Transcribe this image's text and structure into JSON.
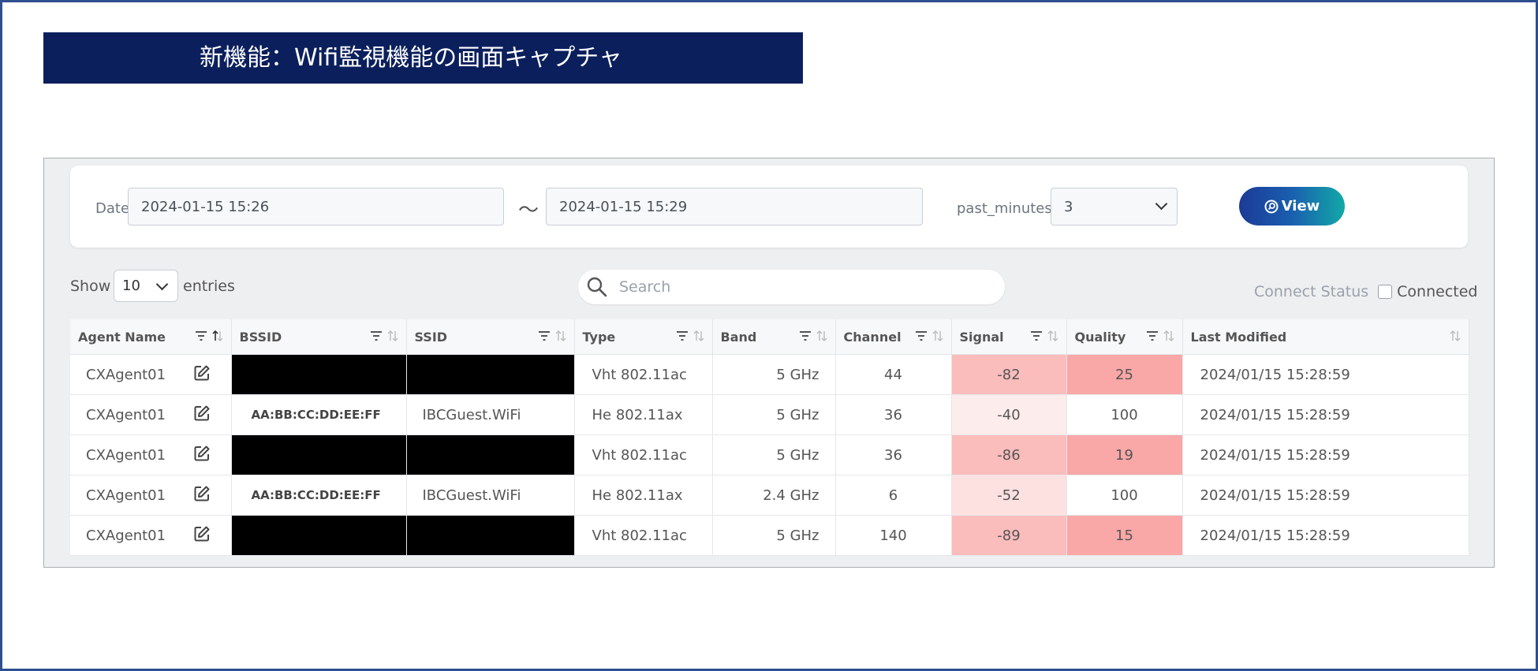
{
  "title": "新機能：Wifi監視機能の画面キャプチャ",
  "filter": {
    "date_label": "Date",
    "date_from": "2024-01-15 15:26",
    "separator": "〜",
    "date_to": "2024-01-15 15:29",
    "past_minutes_label": "past_minutes",
    "past_minutes_value": "3",
    "view_label": "View"
  },
  "table_controls": {
    "show_label": "Show",
    "entries_value": "10",
    "entries_label": "entries",
    "search_placeholder": "Search",
    "connect_status_label": "Connect Status",
    "connected_label": "Connected"
  },
  "columns": [
    "Agent Name",
    "BSSID",
    "SSID",
    "Type",
    "Band",
    "Channel",
    "Signal",
    "Quality",
    "Last Modified"
  ],
  "rows": [
    {
      "agent": "CXAgent01",
      "bssid": "",
      "ssid": "",
      "redacted": true,
      "type": "Vht 802.11ac",
      "band": "5 GHz",
      "channel": "44",
      "signal": "-82",
      "quality": "25",
      "modified": "2024/01/15 15:28:59"
    },
    {
      "agent": "CXAgent01",
      "bssid": "AA:BB:CC:DD:EE:FF",
      "ssid": "IBCGuest.WiFi",
      "redacted": false,
      "type": "He 802.11ax",
      "band": "5 GHz",
      "channel": "36",
      "signal": "-40",
      "quality": "100",
      "modified": "2024/01/15 15:28:59"
    },
    {
      "agent": "CXAgent01",
      "bssid": "",
      "ssid": "",
      "redacted": true,
      "type": "Vht 802.11ac",
      "band": "5 GHz",
      "channel": "36",
      "signal": "-86",
      "quality": "19",
      "modified": "2024/01/15 15:28:59"
    },
    {
      "agent": "CXAgent01",
      "bssid": "AA:BB:CC:DD:EE:FF",
      "ssid": "IBCGuest.WiFi",
      "redacted": false,
      "type": "He 802.11ax",
      "band": "2.4 GHz",
      "channel": "6",
      "signal": "-52",
      "quality": "100",
      "modified": "2024/01/15 15:28:59"
    },
    {
      "agent": "CXAgent01",
      "bssid": "",
      "ssid": "",
      "redacted": true,
      "type": "Vht 802.11ac",
      "band": "5 GHz",
      "channel": "140",
      "signal": "-89",
      "quality": "15",
      "modified": "2024/01/15 15:28:59"
    }
  ],
  "colors": {
    "banner": "#0b1f5c",
    "signal_strong": "#fdecec",
    "signal_medium": "#fde0e0",
    "signal_weak": "#fbbcbc",
    "quality_low": "#f9a7a7",
    "quality_ok": "#ffffff"
  }
}
